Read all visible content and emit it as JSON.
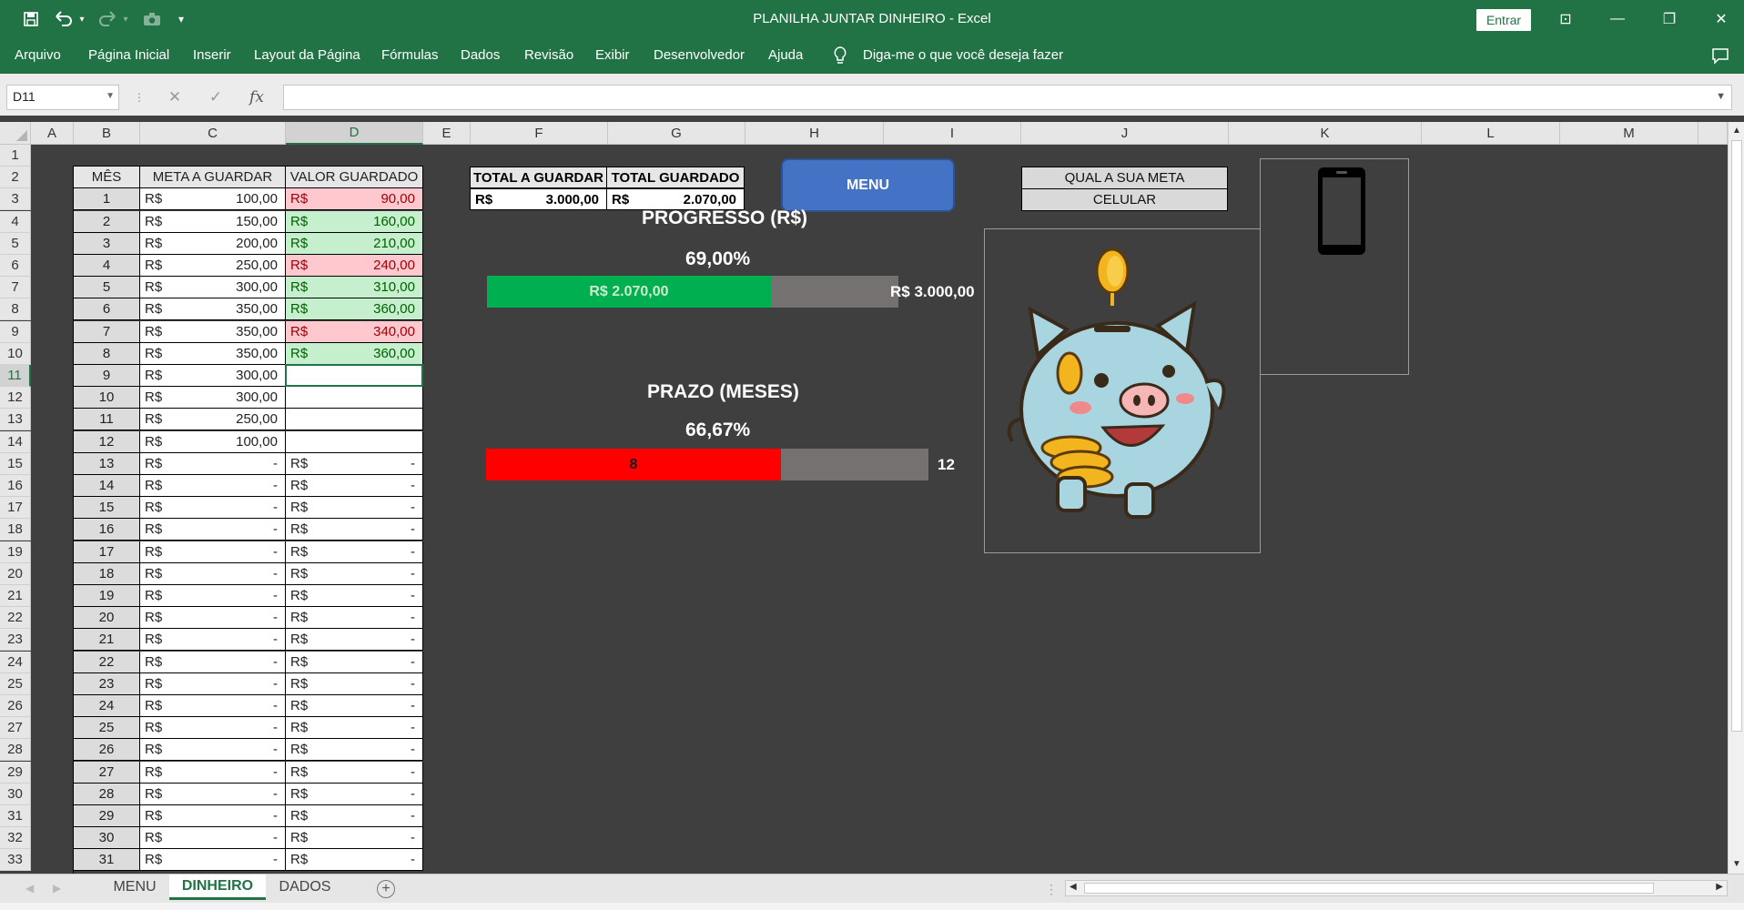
{
  "window": {
    "title": "PLANILHA JUNTAR DINHEIRO  -  Excel",
    "signin_label": "Entrar",
    "minimize_glyph": "—",
    "restore_glyph": "❐",
    "close_glyph": "✕",
    "ribbon_display_glyph": "⊡"
  },
  "quick_access": {
    "save_icon": "save-icon",
    "undo_icon": "undo-icon",
    "redo_icon": "redo-icon",
    "camera_icon": "camera-icon",
    "customize_glyph": "▾"
  },
  "ribbon": {
    "tabs": [
      "Arquivo",
      "Página Inicial",
      "Inserir",
      "Layout da Página",
      "Fórmulas",
      "Dados",
      "Revisão",
      "Exibir",
      "Desenvolvedor",
      "Ajuda"
    ],
    "tell_me": "Diga-me o que você deseja fazer"
  },
  "formula_bar": {
    "name_box": "D11",
    "cancel_glyph": "✕",
    "enter_glyph": "✓",
    "fx_glyph": "fx",
    "value": ""
  },
  "columns": [
    "A",
    "B",
    "C",
    "D",
    "E",
    "F",
    "G",
    "H",
    "I",
    "J",
    "K",
    "L",
    "M"
  ],
  "rows": [
    "1",
    "2",
    "3",
    "4",
    "5",
    "6",
    "7",
    "8",
    "9",
    "10",
    "11",
    "12",
    "13",
    "14",
    "15",
    "16",
    "17",
    "18",
    "19",
    "20",
    "21",
    "22",
    "23",
    "24",
    "25",
    "26",
    "27",
    "28",
    "29",
    "30",
    "31",
    "32",
    "33"
  ],
  "selected_cell": {
    "column": "D",
    "row": "11"
  },
  "table": {
    "headers": [
      "MÊS",
      "META A GUARDAR",
      "VALOR GUARDADO"
    ],
    "currency": "R$",
    "rows": [
      {
        "month": "1",
        "meta": "100,00",
        "valor": "90,00",
        "status": "red"
      },
      {
        "month": "2",
        "meta": "150,00",
        "valor": "160,00",
        "status": "green"
      },
      {
        "month": "3",
        "meta": "200,00",
        "valor": "210,00",
        "status": "green"
      },
      {
        "month": "4",
        "meta": "250,00",
        "valor": "240,00",
        "status": "red"
      },
      {
        "month": "5",
        "meta": "300,00",
        "valor": "310,00",
        "status": "green"
      },
      {
        "month": "6",
        "meta": "350,00",
        "valor": "360,00",
        "status": "green"
      },
      {
        "month": "7",
        "meta": "350,00",
        "valor": "340,00",
        "status": "red"
      },
      {
        "month": "8",
        "meta": "350,00",
        "valor": "360,00",
        "status": "green"
      },
      {
        "month": "9",
        "meta": "300,00",
        "valor": null,
        "status": "empty"
      },
      {
        "month": "10",
        "meta": "300,00",
        "valor": null,
        "status": "empty"
      },
      {
        "month": "11",
        "meta": "250,00",
        "valor": null,
        "status": "empty"
      },
      {
        "month": "12",
        "meta": "100,00",
        "valor": null,
        "status": "empty"
      },
      {
        "month": "13",
        "meta": "-",
        "valor": "-",
        "status": "dash"
      },
      {
        "month": "14",
        "meta": "-",
        "valor": "-",
        "status": "dash"
      },
      {
        "month": "15",
        "meta": "-",
        "valor": "-",
        "status": "dash"
      },
      {
        "month": "16",
        "meta": "-",
        "valor": "-",
        "status": "dash"
      },
      {
        "month": "17",
        "meta": "-",
        "valor": "-",
        "status": "dash"
      },
      {
        "month": "18",
        "meta": "-",
        "valor": "-",
        "status": "dash"
      },
      {
        "month": "19",
        "meta": "-",
        "valor": "-",
        "status": "dash"
      },
      {
        "month": "20",
        "meta": "-",
        "valor": "-",
        "status": "dash"
      },
      {
        "month": "21",
        "meta": "-",
        "valor": "-",
        "status": "dash"
      },
      {
        "month": "22",
        "meta": "-",
        "valor": "-",
        "status": "dash"
      },
      {
        "month": "23",
        "meta": "-",
        "valor": "-",
        "status": "dash"
      },
      {
        "month": "24",
        "meta": "-",
        "valor": "-",
        "status": "dash"
      },
      {
        "month": "25",
        "meta": "-",
        "valor": "-",
        "status": "dash"
      },
      {
        "month": "26",
        "meta": "-",
        "valor": "-",
        "status": "dash"
      },
      {
        "month": "27",
        "meta": "-",
        "valor": "-",
        "status": "dash"
      },
      {
        "month": "28",
        "meta": "-",
        "valor": "-",
        "status": "dash"
      },
      {
        "month": "29",
        "meta": "-",
        "valor": "-",
        "status": "dash"
      },
      {
        "month": "30",
        "meta": "-",
        "valor": "-",
        "status": "dash"
      },
      {
        "month": "31",
        "meta": "-",
        "valor": "-",
        "status": "dash"
      }
    ]
  },
  "summary": {
    "total_a_guardar_label": "TOTAL A GUARDAR",
    "total_guardado_label": "TOTAL GUARDADO",
    "total_a_guardar": "3.000,00",
    "total_guardado": "2.070,00"
  },
  "menu_button": "MENU",
  "meta": {
    "question": "QUAL A SUA META",
    "answer": "CELULAR",
    "image_icon": "phone-icon"
  },
  "piggy_image": "piggy-bank-illustration",
  "progress_money": {
    "title": "PROGRESSO (R$)",
    "percent_text": "69,00%",
    "fraction": 0.69,
    "fill_label": "R$ 2.070,00",
    "end_label": "R$ 3.000,00",
    "fill_color": "#00b050"
  },
  "progress_time": {
    "title": "PRAZO (MESES)",
    "percent_text": "66,67%",
    "fraction": 0.6667,
    "fill_label": "8",
    "end_label": "12",
    "fill_color": "#ff0000"
  },
  "sheets": {
    "tabs": [
      "MENU",
      "DINHEIRO",
      "DADOS"
    ],
    "active": "DINHEIRO",
    "add_glyph": "+"
  },
  "colors": {
    "excel_green": "#217346",
    "sheet_background": "#3f3f3f",
    "good_fill": "#c6efce",
    "bad_fill": "#ffc7ce"
  }
}
